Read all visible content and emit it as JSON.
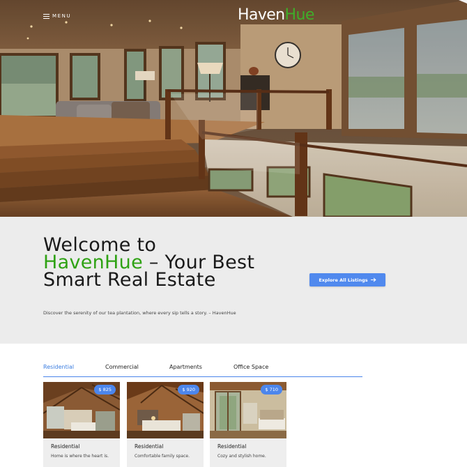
{
  "header": {
    "menu_label": "MENU",
    "menu_icon": "hamburger-icon",
    "logo_part1": "Haven",
    "logo_part2": "Hue",
    "logo_colors": {
      "part1": "#ffffff",
      "part2": "#3fae2a"
    }
  },
  "welcome": {
    "heading_line1": "Welcome to",
    "heading_brand": "HavenHue",
    "heading_rest": " – Your Best Smart Real Estate",
    "description": "Discover the serenity of our tea plantation, where every sip tells a story. – HavenHue",
    "cta_label": "Explore All Listings",
    "cta_icon": "arrow-right-icon",
    "accent_color": "#2fa214",
    "cta_color": "#5089ee"
  },
  "listings": {
    "tabs": [
      {
        "label": "Residential",
        "active": true
      },
      {
        "label": "Commercial",
        "active": false
      },
      {
        "label": "Apartments",
        "active": false
      },
      {
        "label": "Office Space",
        "active": false
      }
    ],
    "cards": [
      {
        "category": "Residential",
        "price": "$ 825",
        "blurb": "Home is where the heart is."
      },
      {
        "category": "Residential",
        "price": "$ 920",
        "blurb": "Comfortable family space."
      },
      {
        "category": "Residential",
        "price": "$ 710",
        "blurb": "Cozy and stylish home."
      }
    ],
    "price_badge_color": "#4c86ec",
    "tab_active_color": "#3b7de0"
  }
}
